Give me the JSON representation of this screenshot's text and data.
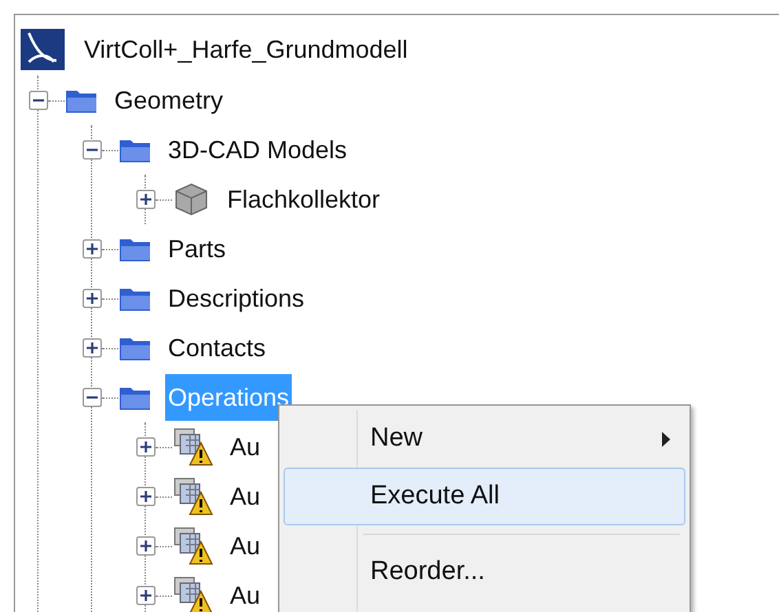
{
  "tree": {
    "label": "VirtColl+_Harfe_Grundmodell",
    "children": [
      {
        "label": "Geometry",
        "kind": "folder",
        "expanded": true,
        "selected": false,
        "children": [
          {
            "label": "3D-CAD Models",
            "kind": "folder",
            "expanded": true,
            "selected": false,
            "children": [
              {
                "label": "Flachkollektor",
                "kind": "model",
                "expanded": false,
                "selected": false
              }
            ]
          },
          {
            "label": "Parts",
            "kind": "folder",
            "expanded": false,
            "selected": false
          },
          {
            "label": "Descriptions",
            "kind": "folder",
            "expanded": false,
            "selected": false
          },
          {
            "label": "Contacts",
            "kind": "folder",
            "expanded": false,
            "selected": false
          },
          {
            "label": "Operations",
            "kind": "folder",
            "expanded": true,
            "selected": true,
            "children": [
              {
                "label": "Au",
                "kind": "operation",
                "expanded": false,
                "selected": false
              },
              {
                "label": "Au",
                "kind": "operation",
                "expanded": false,
                "selected": false
              },
              {
                "label": "Au",
                "kind": "operation",
                "expanded": false,
                "selected": false
              },
              {
                "label": "Au",
                "kind": "operation",
                "expanded": false,
                "selected": false
              }
            ]
          }
        ]
      }
    ]
  },
  "context_menu": {
    "items": [
      {
        "kind": "submenu",
        "label": "New",
        "selected": false
      },
      {
        "kind": "item",
        "label": "Execute All",
        "selected": true
      },
      {
        "kind": "separator"
      },
      {
        "kind": "item",
        "label": "Reorder...",
        "selected": false
      }
    ]
  }
}
